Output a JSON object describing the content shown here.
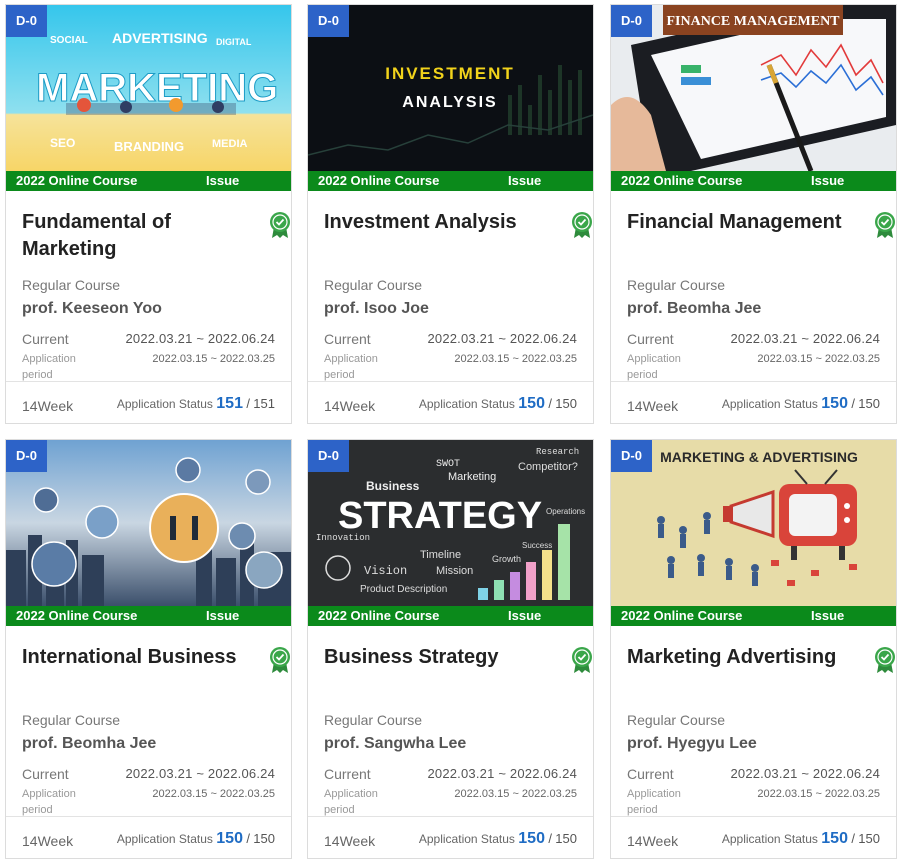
{
  "courses": [
    {
      "dday": "D-0",
      "image_words": [
        "SOCIAL",
        "ADVERTISING",
        "DIGITAL",
        "MARKETING",
        "SEO",
        "BRANDING",
        "MEDIA"
      ],
      "online_label": "2022 Online Course",
      "issue_label": "Issue",
      "title": "Fundamental of Marketing",
      "course_type": "Regular Course",
      "professor": "prof. Keeseon Yoo",
      "current_label": "Current",
      "current_period": "2022.03.21 ~ 2022.06.24",
      "application_label": "Application period",
      "application_period": "2022.03.15 ~ 2022.03.25",
      "duration": "14Week",
      "status_label": "Application Status",
      "applied": "151",
      "slash": "/",
      "capacity": "151"
    },
    {
      "dday": "D-0",
      "image_words": [
        "INVESTMENT",
        "ANALYSIS"
      ],
      "online_label": "2022 Online Course",
      "issue_label": "Issue",
      "title": "Investment Analysis",
      "course_type": "Regular Course",
      "professor": "prof. Isoo Joe",
      "current_label": "Current",
      "current_period": "2022.03.21 ~ 2022.06.24",
      "application_label": "Application period",
      "application_period": "2022.03.15 ~ 2022.03.25",
      "duration": "14Week",
      "status_label": "Application Status",
      "applied": "150",
      "slash": "/",
      "capacity": "150"
    },
    {
      "dday": "D-0",
      "image_words": [
        "FINANCE MANAGEMENT"
      ],
      "online_label": "2022 Online Course",
      "issue_label": "Issue",
      "title": "Financial Management",
      "course_type": "Regular Course",
      "professor": "prof. Beomha Jee",
      "current_label": "Current",
      "current_period": "2022.03.21 ~ 2022.06.24",
      "application_label": "Application period",
      "application_period": "2022.03.15 ~ 2022.03.25",
      "duration": "14Week",
      "status_label": "Application Status",
      "applied": "150",
      "slash": "/",
      "capacity": "150"
    },
    {
      "dday": "D-0",
      "image_words": [],
      "online_label": "2022 Online Course",
      "issue_label": "Issue",
      "title": "International Business",
      "course_type": "Regular Course",
      "professor": "prof. Beomha Jee",
      "current_label": "Current",
      "current_period": "2022.03.21 ~ 2022.06.24",
      "application_label": "Application period",
      "application_period": "2022.03.15 ~ 2022.03.25",
      "duration": "14Week",
      "status_label": "Application Status",
      "applied": "150",
      "slash": "/",
      "capacity": "150"
    },
    {
      "dday": "D-0",
      "image_words": [
        "STRATEGY",
        "Business",
        "SWOT",
        "Marketing",
        "Vision",
        "Mission",
        "Timeline",
        "Growth",
        "Success",
        "Research",
        "Competitor?",
        "Operations",
        "Product Description",
        "Innovation"
      ],
      "online_label": "2022 Online Course",
      "issue_label": "Issue",
      "title": "Business Strategy",
      "course_type": "Regular Course",
      "professor": "prof. Sangwha Lee",
      "current_label": "Current",
      "current_period": "2022.03.21 ~ 2022.06.24",
      "application_label": "Application period",
      "application_period": "2022.03.15 ~ 2022.03.25",
      "duration": "14Week",
      "status_label": "Application Status",
      "applied": "150",
      "slash": "/",
      "capacity": "150"
    },
    {
      "dday": "D-0",
      "image_words": [
        "MARKETING & ADVERTISING"
      ],
      "online_label": "2022 Online Course",
      "issue_label": "Issue",
      "title": "Marketing Advertising",
      "course_type": "Regular Course",
      "professor": "prof. Hyegyu Lee",
      "current_label": "Current",
      "current_period": "2022.03.21 ~ 2022.06.24",
      "application_label": "Application period",
      "application_period": "2022.03.15 ~ 2022.03.25",
      "duration": "14Week",
      "status_label": "Application Status",
      "applied": "150",
      "slash": "/",
      "capacity": "150"
    }
  ],
  "colors": {
    "dday_badge": "#2d63c8",
    "issue_band": "#0b8a1b",
    "status_count": "#1f6cc4",
    "certified_badge": "#3aa64a"
  }
}
